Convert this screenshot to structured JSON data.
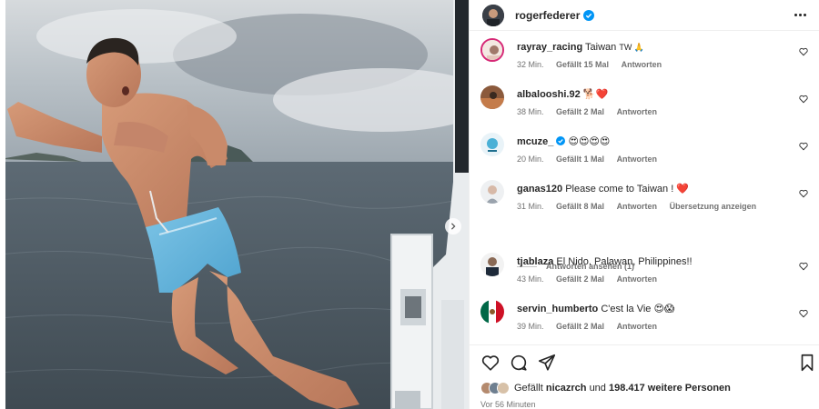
{
  "post": {
    "owner": "rogerfederer",
    "icons": {
      "more": "more-options-icon",
      "verified": "verified-badge-icon"
    }
  },
  "colors": {
    "verified": "#0095f6",
    "heart_red": "#ed1c24",
    "muted": "#737373",
    "text": "#262626"
  },
  "comments": [
    {
      "user": "rayray_racing",
      "text": "Taiwan",
      "emoji": "TW 🙏",
      "time": "32 Min.",
      "likes": "Gefällt 15 Mal",
      "reply": "Antworten",
      "verified": false
    },
    {
      "user": "albalooshi.92",
      "text": "",
      "emoji": "🐕❤️",
      "time": "38 Min.",
      "likes": "Gefällt 2 Mal",
      "reply": "Antworten",
      "verified": false
    },
    {
      "user": "mcuze_",
      "text": "",
      "emoji": "😍😍😍😍",
      "time": "20 Min.",
      "likes": "Gefällt 1 Mal",
      "reply": "Antworten",
      "verified": true
    },
    {
      "user": "ganas120",
      "text": "Please come to Taiwan !",
      "emoji": "❤️",
      "time": "31 Min.",
      "likes": "Gefällt 8 Mal",
      "reply": "Antworten",
      "translate": "Übersetzung anzeigen",
      "verified": false
    },
    {
      "user": "tjablaza",
      "text": "El Nido, Palawan, Philippines!!",
      "emoji": "",
      "time": "43 Min.",
      "likes": "Gefällt 2 Mal",
      "reply": "Antworten",
      "verified": false
    },
    {
      "user": "servin_humberto",
      "text": "C'est la Vie",
      "emoji": "😍😱",
      "time": "39 Min.",
      "likes": "Gefällt 2 Mal",
      "reply": "Antworten",
      "verified": false
    }
  ],
  "view_replies": "Antworten ansehen (1)",
  "actions": {
    "like": "heart-icon",
    "comment": "comment-icon",
    "share": "share-icon",
    "save": "bookmark-icon"
  },
  "likes_line": {
    "prefix": "Gefällt",
    "user": "nicazrch",
    "middle": "und",
    "count": "198.417 weitere Personen"
  },
  "posted": "Vor 56 Minuten"
}
